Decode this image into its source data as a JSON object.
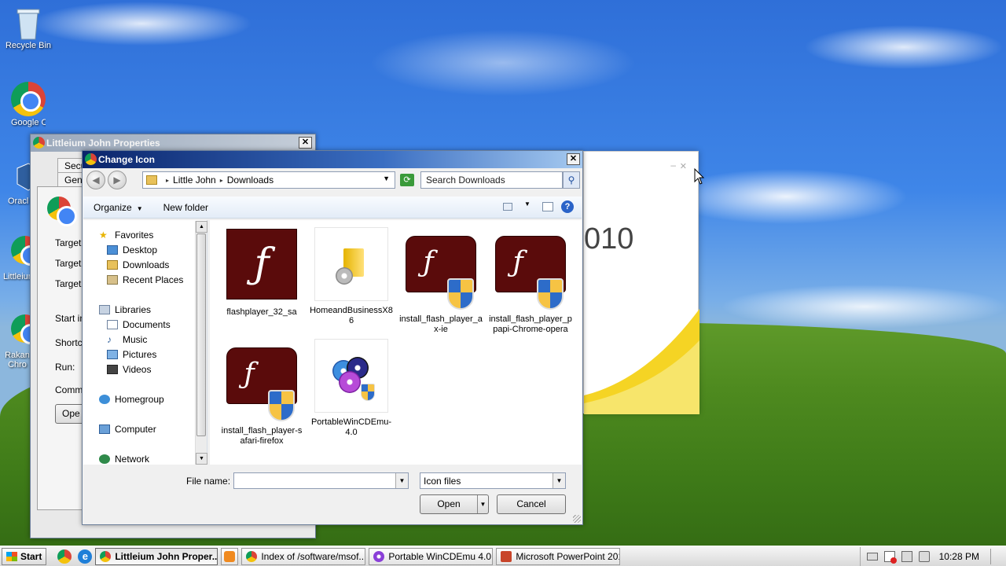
{
  "desktop": {
    "icons": [
      {
        "label": "Recycle Bin"
      },
      {
        "label": "Google Chro"
      },
      {
        "label": "Oracl Virtua"
      },
      {
        "label": "Littleium"
      },
      {
        "label": "Rakan Chro"
      }
    ]
  },
  "props_window": {
    "title": "Littleium John Properties",
    "close": "✕",
    "tabs": [
      "Secu",
      "Gen"
    ],
    "labels": [
      "Target ty",
      "Target lo",
      "Target:",
      "Start in:",
      "Shortcu",
      "Run:",
      "Commen"
    ],
    "open_button": "Ope"
  },
  "ppt_window": {
    "partial_title": "010",
    "min": "–",
    "close": "✕"
  },
  "dialog": {
    "title": "Change Icon",
    "close": "✕",
    "breadcrumb": [
      "Little John",
      "Downloads"
    ],
    "search_placeholder": "Search Downloads",
    "organize": "Organize",
    "new_folder": "New folder",
    "help": "?",
    "nav": {
      "favorites": "Favorites",
      "desktop": "Desktop",
      "downloads": "Downloads",
      "recent": "Recent Places",
      "libraries": "Libraries",
      "documents": "Documents",
      "music": "Music",
      "pictures": "Pictures",
      "videos": "Videos",
      "homegroup": "Homegroup",
      "computer": "Computer",
      "network": "Network"
    },
    "files": [
      {
        "name": "flashplayer_32_sa",
        "icon": "flash-icon"
      },
      {
        "name": "HomeandBusinessX86",
        "icon": "office-setup-icon"
      },
      {
        "name": "install_flash_player_ax-ie",
        "icon": "flash-shield-icon"
      },
      {
        "name": "install_flash_player_ppapi-Chrome-opera",
        "icon": "flash-shield-icon"
      },
      {
        "name": "install_flash_player-safari-firefox",
        "icon": "flash-shield-icon"
      },
      {
        "name": "PortableWinCDEmu-4.0",
        "icon": "wincdemu-icon"
      }
    ],
    "file_name_label": "File name:",
    "file_name_value": "",
    "filter_value": "Icon files",
    "open": "Open",
    "cancel": "Cancel"
  },
  "taskbar": {
    "start": "Start",
    "tasks": [
      {
        "label": "Littleium John Proper...",
        "active": true
      },
      {
        "label": "",
        "active": false
      },
      {
        "label": "Index of /software/msof...",
        "active": false
      },
      {
        "label": "Portable WinCDEmu 4.0",
        "active": false
      },
      {
        "label": "Microsoft PowerPoint 2010",
        "active": false
      }
    ],
    "clock": "10:28 PM"
  }
}
